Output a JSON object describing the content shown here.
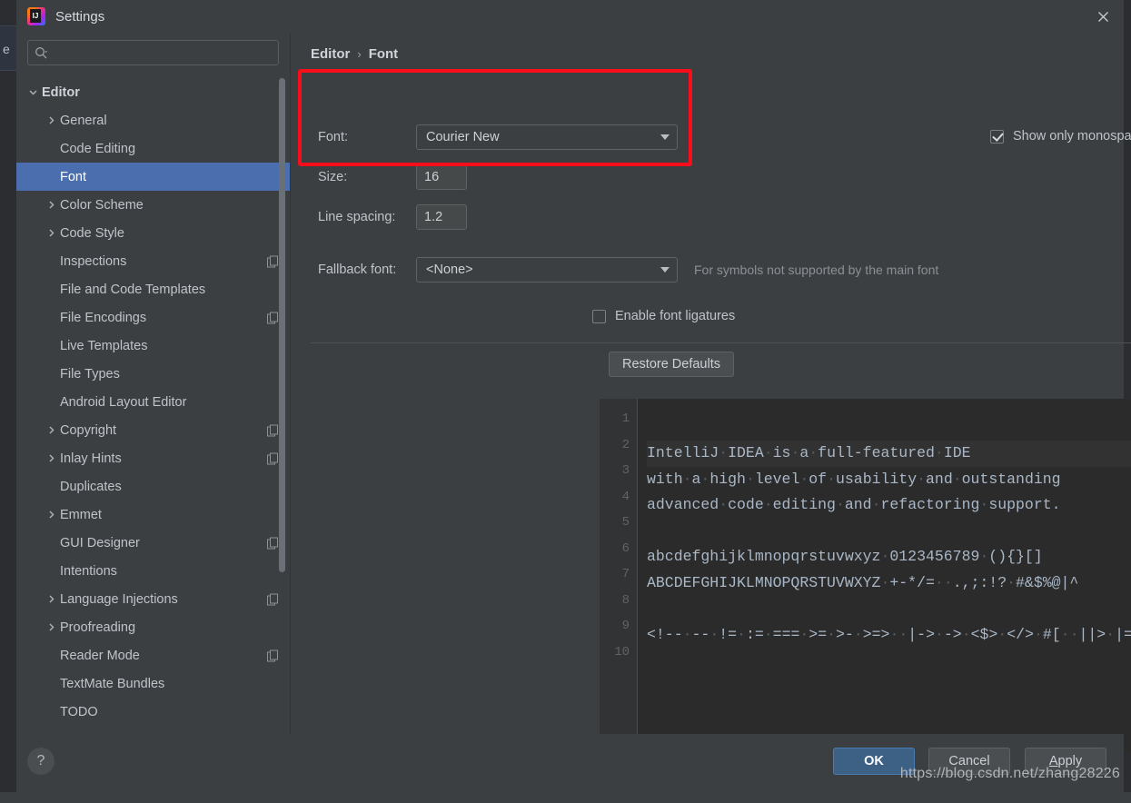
{
  "background": {
    "tab_label": "e"
  },
  "window": {
    "title": "Settings",
    "app_icon": "intellij-idea-icon",
    "close_icon": "close-icon"
  },
  "sidebar": {
    "search": {
      "placeholder": "",
      "value": "",
      "icon": "search-icon"
    },
    "items": [
      {
        "label": "Editor",
        "level": 0,
        "arrow": "down",
        "selected": false,
        "badge": false
      },
      {
        "label": "General",
        "level": 1,
        "arrow": "right",
        "selected": false,
        "badge": false
      },
      {
        "label": "Code Editing",
        "level": 1,
        "arrow": "none",
        "selected": false,
        "badge": false
      },
      {
        "label": "Font",
        "level": 1,
        "arrow": "none",
        "selected": true,
        "badge": false
      },
      {
        "label": "Color Scheme",
        "level": 1,
        "arrow": "right",
        "selected": false,
        "badge": false
      },
      {
        "label": "Code Style",
        "level": 1,
        "arrow": "right",
        "selected": false,
        "badge": false
      },
      {
        "label": "Inspections",
        "level": 1,
        "arrow": "none",
        "selected": false,
        "badge": true
      },
      {
        "label": "File and Code Templates",
        "level": 1,
        "arrow": "none",
        "selected": false,
        "badge": false
      },
      {
        "label": "File Encodings",
        "level": 1,
        "arrow": "none",
        "selected": false,
        "badge": true
      },
      {
        "label": "Live Templates",
        "level": 1,
        "arrow": "none",
        "selected": false,
        "badge": false
      },
      {
        "label": "File Types",
        "level": 1,
        "arrow": "none",
        "selected": false,
        "badge": false
      },
      {
        "label": "Android Layout Editor",
        "level": 1,
        "arrow": "none",
        "selected": false,
        "badge": false
      },
      {
        "label": "Copyright",
        "level": 1,
        "arrow": "right",
        "selected": false,
        "badge": true
      },
      {
        "label": "Inlay Hints",
        "level": 1,
        "arrow": "right",
        "selected": false,
        "badge": true
      },
      {
        "label": "Duplicates",
        "level": 1,
        "arrow": "none",
        "selected": false,
        "badge": false
      },
      {
        "label": "Emmet",
        "level": 1,
        "arrow": "right",
        "selected": false,
        "badge": false
      },
      {
        "label": "GUI Designer",
        "level": 1,
        "arrow": "none",
        "selected": false,
        "badge": true
      },
      {
        "label": "Intentions",
        "level": 1,
        "arrow": "none",
        "selected": false,
        "badge": false
      },
      {
        "label": "Language Injections",
        "level": 1,
        "arrow": "right",
        "selected": false,
        "badge": true
      },
      {
        "label": "Proofreading",
        "level": 1,
        "arrow": "right",
        "selected": false,
        "badge": false
      },
      {
        "label": "Reader Mode",
        "level": 1,
        "arrow": "none",
        "selected": false,
        "badge": true
      },
      {
        "label": "TextMate Bundles",
        "level": 1,
        "arrow": "none",
        "selected": false,
        "badge": false
      },
      {
        "label": "TODO",
        "level": 1,
        "arrow": "none",
        "selected": false,
        "badge": false
      }
    ]
  },
  "content": {
    "breadcrumb": {
      "root": "Editor",
      "separator": "›",
      "leaf": "Font"
    },
    "font_label": "Font:",
    "font_value": "Courier New",
    "size_label": "Size:",
    "size_value": "16",
    "line_spacing_label": "Line spacing:",
    "line_spacing_value": "1.2",
    "monospaced_checkbox": {
      "label": "Show only monospaced fonts",
      "checked": true
    },
    "fallback_label": "Fallback font:",
    "fallback_value": "<None>",
    "fallback_hint": "For symbols not supported by the main font",
    "ligatures_checkbox": {
      "label": "Enable font ligatures",
      "checked": false
    },
    "restore_defaults": "Restore Defaults"
  },
  "preview": {
    "line_numbers": [
      "1",
      "2",
      "3",
      "4",
      "5",
      "6",
      "7",
      "8",
      "9",
      "10"
    ],
    "lines": [
      "IntelliJ·IDEA·is·a·full-featured·IDE",
      "with·a·high·level·of·usability·and·outstanding",
      "advanced·code·editing·and·refactoring·support.",
      "",
      "abcdefghijklmnopqrstuvwxyz·0123456789·(){}[]",
      "ABCDEFGHIJKLMNOPQRSTUVWXYZ·+-*/=··.,;:!?·#&$%@|^",
      "",
      "<!--·--·!=·:=·===·>=·>-·>=>··|->·->·<$>·</>·#[··||>·|=··~@",
      "",
      ""
    ],
    "caret_line_index": 0
  },
  "footer": {
    "help": "?",
    "ok": "OK",
    "cancel": "Cancel",
    "apply_prefix": "A",
    "apply_rest": "pply"
  },
  "watermark": "https://blog.csdn.net/zhang28226",
  "colors": {
    "dialog_bg": "#3c3f41",
    "selection_blue": "#4b6eaf",
    "ok_button": "#3d6185",
    "annotation_red": "#fc0d1b",
    "editor_bg": "#2b2b2b",
    "code_text": "#a9b7c6"
  }
}
